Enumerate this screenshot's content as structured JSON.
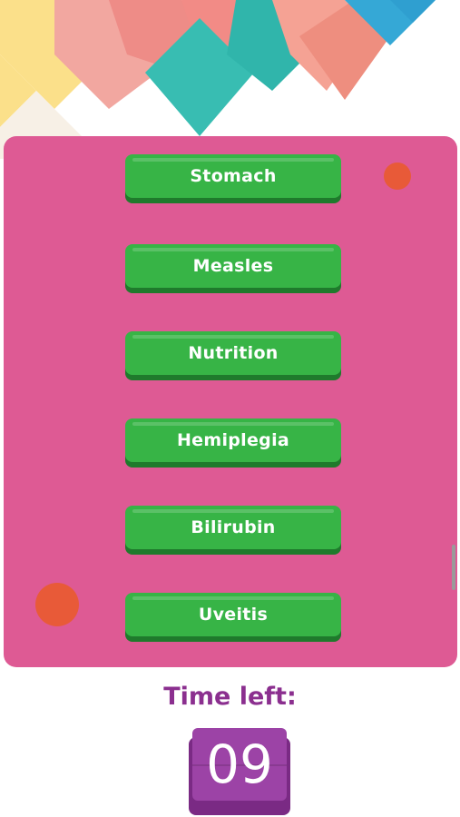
{
  "quiz": {
    "answers": [
      {
        "label": "Stomach"
      },
      {
        "label": "Measles"
      },
      {
        "label": "Nutrition"
      },
      {
        "label": "Hemiplegia"
      },
      {
        "label": "Bilirubin"
      },
      {
        "label": "Uveitis"
      }
    ]
  },
  "timer": {
    "label": "Time left:",
    "value": "09"
  },
  "colors": {
    "panel": "#de5a94",
    "button": "#37b446",
    "button_shadow": "#1f7a2c",
    "timer_text": "#8b2f8f",
    "timer_box": "#9c43a6",
    "accent_dot": "#e85a38"
  }
}
